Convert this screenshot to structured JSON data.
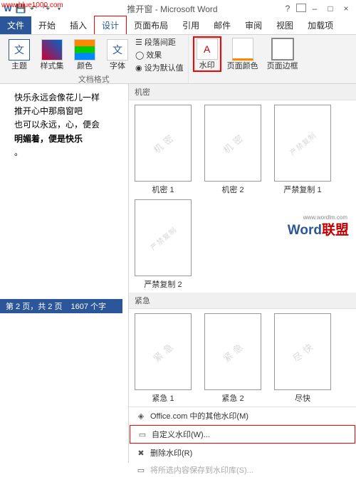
{
  "url_watermark": "www.blue1000.com",
  "title": "推开窗 - Microsoft Word",
  "tabs": {
    "file": "文件",
    "home": "开始",
    "insert": "插入",
    "design": "设计",
    "layout": "页面布局",
    "references": "引用",
    "mailings": "邮件",
    "review": "审阅",
    "view": "视图",
    "addins": "加载项"
  },
  "ribbon": {
    "themes": "主题",
    "styles": "样式集",
    "colors": "颜色",
    "fonts": "字体",
    "para_spacing": "段落间距",
    "effects": "效果",
    "set_default": "设为默认值",
    "group_doc_format": "文档格式",
    "watermark": "水印",
    "page_color": "页面颜色",
    "page_border": "页面边框"
  },
  "doc": {
    "line1": "快乐永远会像花儿一样",
    "line2": "    推开心中那扇窗吧",
    "line3": "也可以永远，心，便会",
    "line4": "明媚着，便是快乐",
    "line5": "。"
  },
  "gallery": {
    "section_confidential": "机密",
    "section_urgent": "紧急",
    "thumbs": {
      "c1": {
        "wm": "机 密",
        "label": "机密 1"
      },
      "c2": {
        "wm": "机 密",
        "label": "机密 2"
      },
      "nc1": {
        "wm": "严禁复制",
        "label": "严禁复制 1"
      },
      "nc2": {
        "wm": "严禁复制",
        "label": "严禁复制 2"
      },
      "u1": {
        "wm": "紧 急",
        "label": "紧急 1"
      },
      "u2": {
        "wm": "紧 急",
        "label": "紧急 2"
      },
      "asap": {
        "wm": "尽 快",
        "label": "尽快"
      }
    }
  },
  "brand": {
    "blue": "Word",
    "red": "联盟",
    "tiny": "www.wordlm.com"
  },
  "menu": {
    "office_more": "Office.com 中的其他水印(M)",
    "custom": "自定义水印(W)...",
    "remove": "删除水印(R)",
    "save_selection": "将所选内容保存到水印库(S)..."
  },
  "status": {
    "page": "第 2 页，共 2 页",
    "words": "1607 个字"
  }
}
